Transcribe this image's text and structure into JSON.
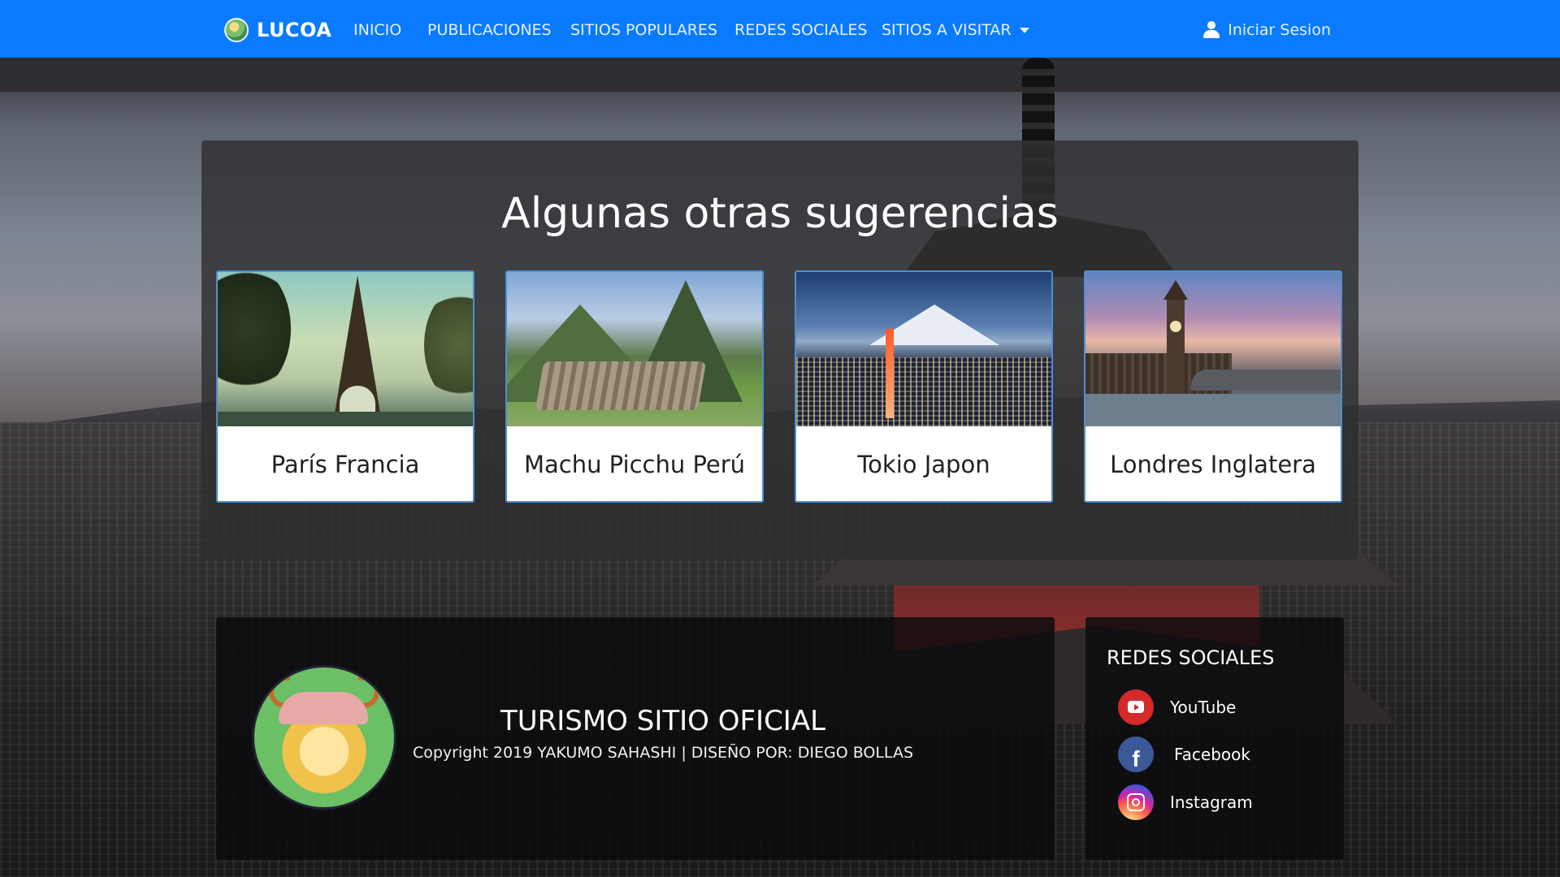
{
  "navbar": {
    "brand": "LUCOA",
    "links": [
      {
        "label": "INICIO"
      },
      {
        "label": "PUBLICACIONES"
      },
      {
        "label": "SITIOS POPULARES"
      },
      {
        "label": "REDES SOCIALES"
      },
      {
        "label": "SITIOS A VISITAR"
      }
    ],
    "login_label": "Iniciar Sesion",
    "color": "#0a7bff"
  },
  "suggestions": {
    "title": "Algunas otras sugerencias",
    "cards": [
      {
        "label": "París Francia",
        "image": "eiffel-tower"
      },
      {
        "label": "Machu Picchu Perú",
        "image": "machu-picchu"
      },
      {
        "label": "Tokio Japon",
        "image": "tokyo-tower-fuji"
      },
      {
        "label": "Londres Inglatera",
        "image": "big-ben-london"
      }
    ]
  },
  "footer": {
    "title": "TURISMO SITIO OFICIAL",
    "copyright": "Copyright 2019 YAKUMO SAHASHI | DISEÑO POR: DIEGO BOLLAS",
    "social": {
      "title": "REDES SOCIALES",
      "items": [
        {
          "label": "YouTube",
          "icon": "youtube-icon"
        },
        {
          "label": "Facebook",
          "icon": "facebook-icon"
        },
        {
          "label": "Instagram",
          "icon": "instagram-icon"
        }
      ]
    }
  }
}
